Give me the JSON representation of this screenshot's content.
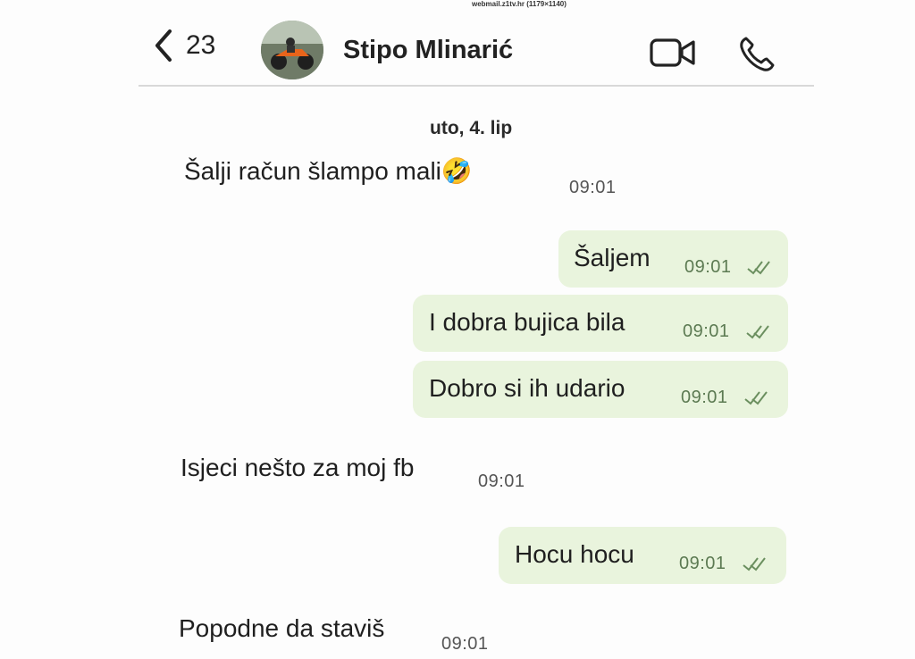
{
  "print_header": "webmail.z1tv.hr (1179×1140)",
  "header": {
    "back_count": "23",
    "contact_name": "Stipo Mlinarić"
  },
  "date_separator": "uto, 4. lip",
  "colors": {
    "outgoing_bubble": "#e9f4dd",
    "tick_color": "#6b8f5f"
  },
  "messages": [
    {
      "direction": "incoming",
      "text": "Šalji račun šlampo mali🤣",
      "time": "09:01"
    },
    {
      "direction": "outgoing",
      "text": "Šaljem",
      "time": "09:01",
      "status": "read"
    },
    {
      "direction": "outgoing",
      "text": "I dobra bujica bila",
      "time": "09:01",
      "status": "read"
    },
    {
      "direction": "outgoing",
      "text": "Dobro si ih udario",
      "time": "09:01",
      "status": "read"
    },
    {
      "direction": "incoming",
      "text": "Isjeci nešto za moj fb",
      "time": "09:01"
    },
    {
      "direction": "outgoing",
      "text": "Hocu hocu",
      "time": "09:01",
      "status": "read"
    },
    {
      "direction": "incoming",
      "text": "Popodne da staviš",
      "time": "09:01"
    }
  ]
}
